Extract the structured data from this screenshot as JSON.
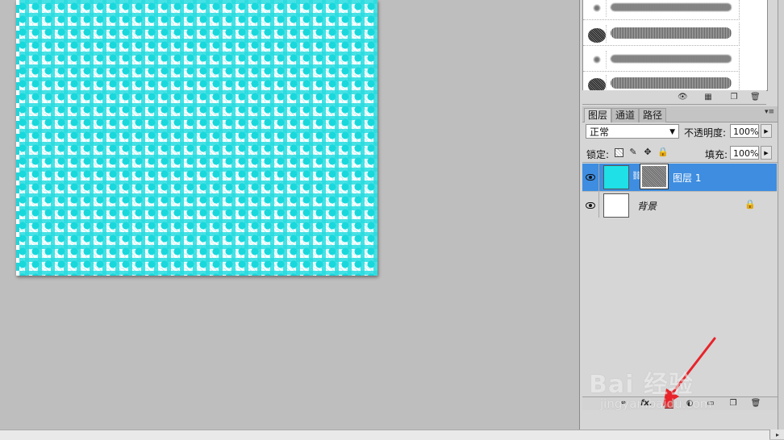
{
  "canvas": {
    "pattern_colors": {
      "primary": "#18d8dc",
      "secondary": "#ffffff"
    }
  },
  "layers_panel": {
    "tabs": [
      {
        "label": "图层",
        "active": true
      },
      {
        "label": "通道",
        "active": false
      },
      {
        "label": "路径",
        "active": false
      }
    ],
    "menu_icon": "panel-menu-icon",
    "blend_mode": "正常",
    "opacity_label": "不透明度:",
    "opacity_value": "100%",
    "lock_label": "锁定:",
    "lock_icons": [
      "lock-transparent-icon",
      "lock-brush-icon",
      "lock-move-icon",
      "lock-all-icon"
    ],
    "fill_label": "填充:",
    "fill_value": "100%",
    "layers": [
      {
        "name": "图层 1",
        "selected": true,
        "visible": true,
        "thumbnail_color": "#1fe0e6",
        "has_mask": true
      },
      {
        "name": "背景",
        "selected": false,
        "visible": true,
        "thumbnail_color": "#ffffff",
        "locked": true
      }
    ],
    "footer_icons": [
      "link-layers-icon",
      "fx-icon",
      "add-mask-icon",
      "adjustment-layer-icon",
      "new-group-icon",
      "new-layer-icon",
      "trash-icon"
    ],
    "fx_label": "fx."
  },
  "brushes_panel": {
    "footer_icons": [
      "eye-brush-icon",
      "grid-icon",
      "new-preset-icon",
      "trash-icon"
    ]
  },
  "watermark": {
    "logo": "Bai 经验",
    "url": "jingyan.baidu.com"
  },
  "colors": {
    "selection": "#3e8de0",
    "annotation_arrow": "#e8232a"
  }
}
